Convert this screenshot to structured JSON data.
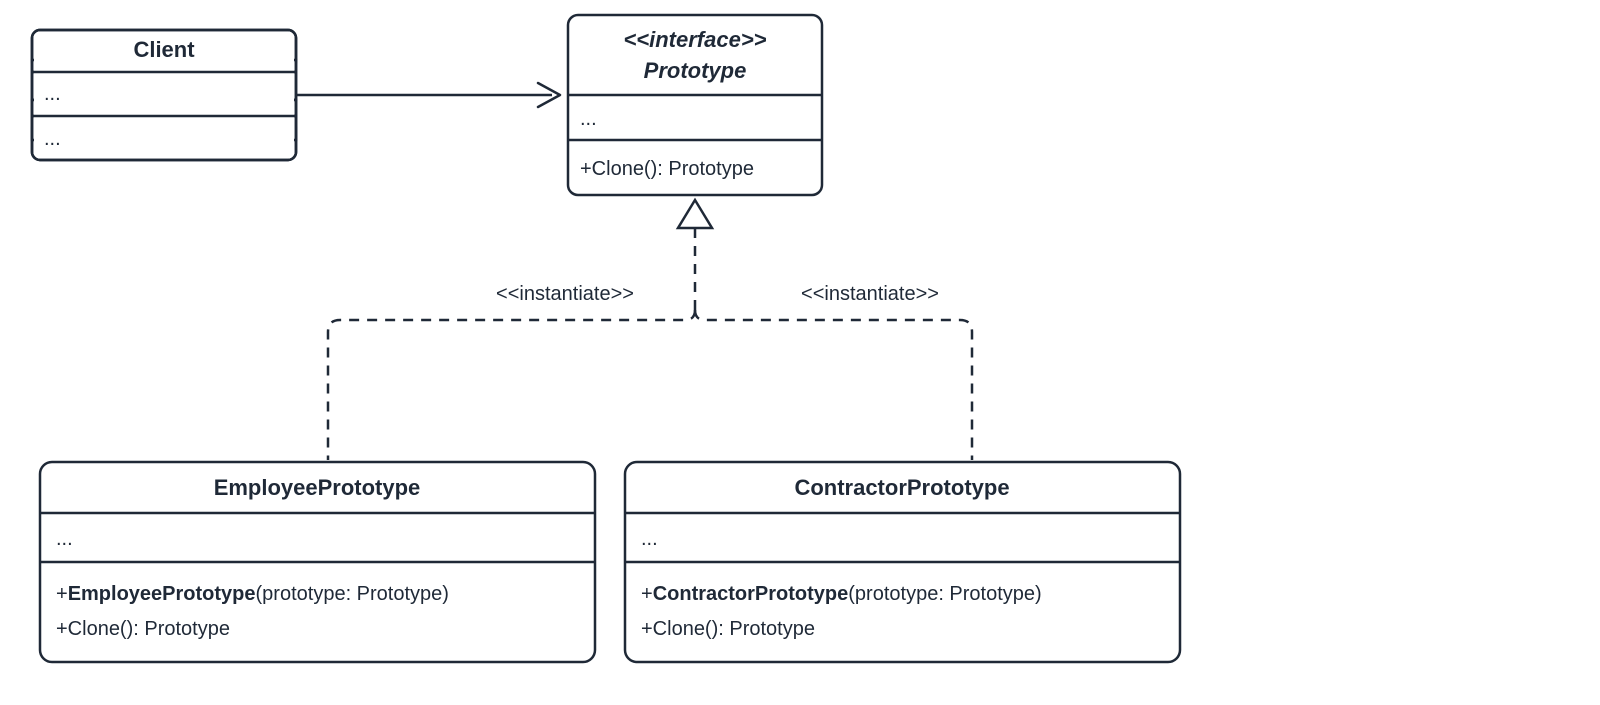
{
  "client": {
    "title": "Client",
    "attrs": "...",
    "methods": "..."
  },
  "prototype": {
    "stereotype": "<<interface>>",
    "title": "Prototype",
    "attrs": "...",
    "method": "+Clone(): Prototype"
  },
  "employee": {
    "title": "EmployeePrototype",
    "attrs": "...",
    "ctor_prefix": "+",
    "ctor_name": "EmployeePrototype",
    "ctor_args": "(prototype: Prototype)",
    "method": "+Clone(): Prototype"
  },
  "contractor": {
    "title": "ContractorPrototype",
    "attrs": "...",
    "ctor_prefix": "+",
    "ctor_name": "ContractorPrototype",
    "ctor_args": "(prototype: Prototype)",
    "method": "+Clone(): Prototype"
  },
  "labels": {
    "instantiate_left": "<<instantiate>>",
    "instantiate_right": "<<instantiate>>"
  }
}
